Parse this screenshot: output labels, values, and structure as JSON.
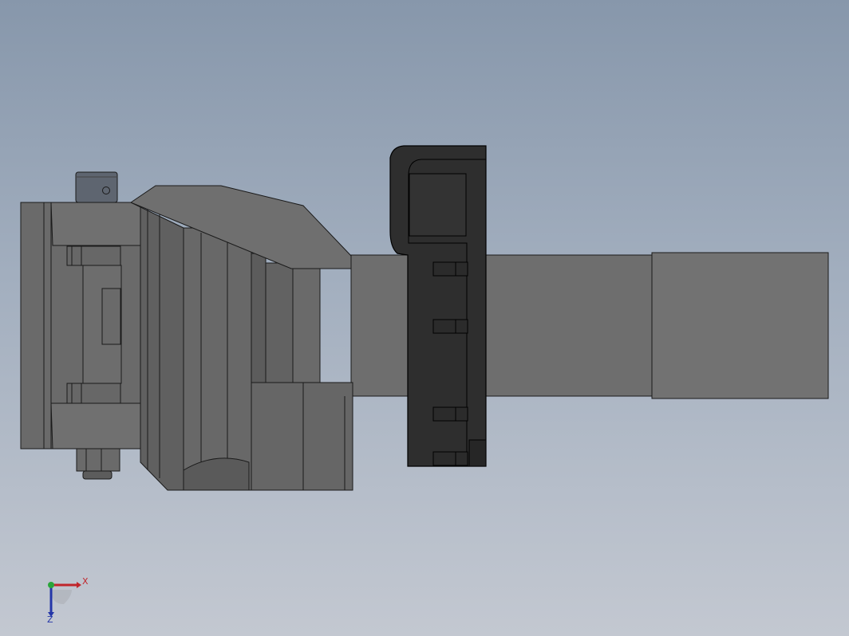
{
  "viewport": {
    "background_top": "#8797ab",
    "background_bottom": "#c3c8d1"
  },
  "model": {
    "body_color": "#6b6b6b",
    "dark_part_color": "#2e2e2e",
    "cap_color": "#5e6570"
  },
  "triad": {
    "x_label": "X",
    "z_label": "Z",
    "x_color": "#c0262c",
    "y_color": "#2aa53a",
    "z_color": "#2436a8"
  }
}
